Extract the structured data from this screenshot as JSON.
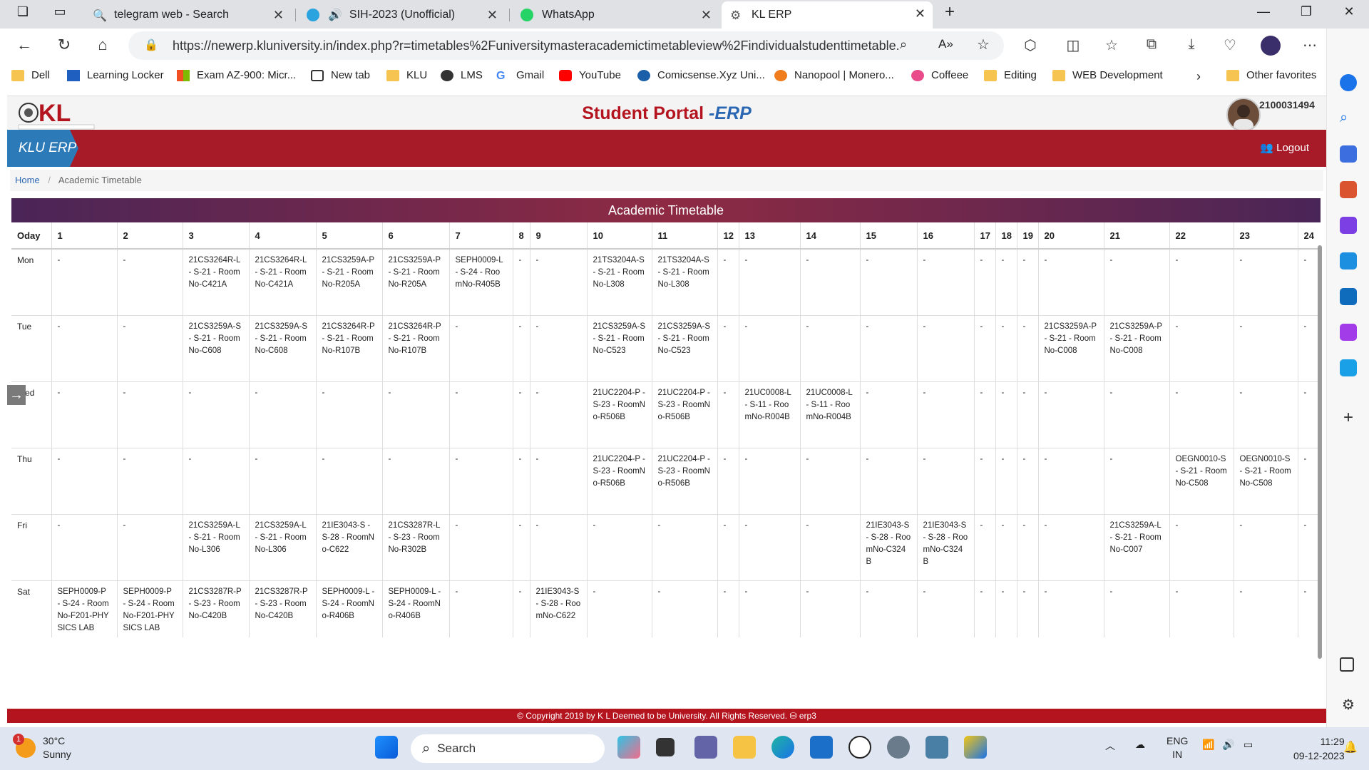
{
  "browser": {
    "tabs": [
      {
        "title": "telegram web - Search",
        "icon": "search-icon",
        "active": false
      },
      {
        "title": "SIH-2023 (Unofficial)",
        "icon": "telegram-icon",
        "active": false
      },
      {
        "title": "WhatsApp",
        "icon": "whatsapp-icon",
        "active": false
      },
      {
        "title": "KL ERP",
        "icon": "gear-icon",
        "active": true
      }
    ],
    "url": "https://newerp.kluniversity.in/index.php?r=timetables%2Funiversitymasteracademictimetableview%2Findividualstudenttimetable...",
    "bookmarks": [
      "Dell",
      "Learning Locker",
      "Exam AZ-900: Micr...",
      "New tab",
      "KLU",
      "LMS",
      "Gmail",
      "YouTube",
      "Comicsense.Xyz Uni...",
      "Nanopool | Monero...",
      "Coffeee",
      "Editing",
      "WEB Development",
      "Other favorites"
    ]
  },
  "portal": {
    "title": "Student Portal",
    "title_suffix": "-ERP",
    "student_id": "2100031494",
    "brand": "KLU ERP",
    "logout": "Logout",
    "breadcrumb_home": "Home",
    "breadcrumb_current": "Academic Timetable",
    "timetable_title": "Academic Timetable",
    "footer": "© Copyright 2019 by K L Deemed to be University. All Rights Reserved. ⛁ erp3"
  },
  "timetable": {
    "headers": [
      "Oday",
      "1",
      "2",
      "3",
      "4",
      "5",
      "6",
      "7",
      "8",
      "9",
      "10",
      "11",
      "12",
      "13",
      "14",
      "15",
      "16",
      "17",
      "18",
      "19",
      "20",
      "21",
      "22",
      "23",
      "24"
    ],
    "rows": [
      [
        "Mon",
        "-",
        "-",
        "21CS3264R-L - S-21 - RoomNo-C421A",
        "21CS3264R-L - S-21 - RoomNo-C421A",
        "21CS3259A-P - S-21 - RoomNo-R205A",
        "21CS3259A-P - S-21 - RoomNo-R205A",
        "SEPH0009-L - S-24 - RoomNo-R405B",
        "-",
        "-",
        "21TS3204A-S - S-21 - RoomNo-L308",
        "21TS3204A-S - S-21 - RoomNo-L308",
        "-",
        "-",
        "-",
        "-",
        "-",
        "-",
        "-",
        "-",
        "-",
        "-",
        "-",
        "-",
        "-"
      ],
      [
        "Tue",
        "-",
        "-",
        "21CS3259A-S - S-21 - RoomNo-C608",
        "21CS3259A-S - S-21 - RoomNo-C608",
        "21CS3264R-P - S-21 - RoomNo-R107B",
        "21CS3264R-P - S-21 - RoomNo-R107B",
        "-",
        "-",
        "-",
        "21CS3259A-S - S-21 - RoomNo-C523",
        "21CS3259A-S - S-21 - RoomNo-C523",
        "-",
        "-",
        "-",
        "-",
        "-",
        "-",
        "-",
        "-",
        "21CS3259A-P - S-21 - RoomNo-C008",
        "21CS3259A-P - S-21 - RoomNo-C008",
        "-",
        "-",
        "-"
      ],
      [
        "Wed",
        "-",
        "-",
        "-",
        "-",
        "-",
        "-",
        "-",
        "-",
        "-",
        "21UC2204-P - S-23 - RoomNo-R506B",
        "21UC2204-P - S-23 - RoomNo-R506B",
        "-",
        "21UC0008-L - S-11 - RoomNo-R004B",
        "21UC0008-L - S-11 - RoomNo-R004B",
        "-",
        "-",
        "-",
        "-",
        "-",
        "-",
        "-",
        "-",
        "-",
        "-"
      ],
      [
        "Thu",
        "-",
        "-",
        "-",
        "-",
        "-",
        "-",
        "-",
        "-",
        "-",
        "21UC2204-P - S-23 - RoomNo-R506B",
        "21UC2204-P - S-23 - RoomNo-R506B",
        "-",
        "-",
        "-",
        "-",
        "-",
        "-",
        "-",
        "-",
        "-",
        "-",
        "OEGN0010-S - S-21 - RoomNo-C508",
        "OEGN0010-S - S-21 - RoomNo-C508",
        "-"
      ],
      [
        "Fri",
        "-",
        "-",
        "21CS3259A-L - S-21 - RoomNo-L306",
        "21CS3259A-L - S-21 - RoomNo-L306",
        "21IE3043-S - S-28 - RoomNo-C622",
        "21CS3287R-L - S-23 - RoomNo-R302B",
        "-",
        "-",
        "-",
        "-",
        "-",
        "-",
        "-",
        "-",
        "21IE3043-S - S-28 - RoomNo-C324B",
        "21IE3043-S - S-28 - RoomNo-C324B",
        "-",
        "-",
        "-",
        "-",
        "21CS3259A-L - S-21 - RoomNo-C007",
        "-",
        "-",
        "-"
      ],
      [
        "Sat",
        "SEPH0009-P - S-24 - RoomNo-F201-PHYSICS LAB",
        "SEPH0009-P - S-24 - RoomNo-F201-PHYSICS LAB",
        "21CS3287R-P - S-23 - RoomNo-C420B",
        "21CS3287R-P - S-23 - RoomNo-C420B",
        "SEPH0009-L - S-24 - RoomNo-R406B",
        "SEPH0009-L - S-24 - RoomNo-R406B",
        "-",
        "-",
        "21IE3043-S - S-28 - RoomNo-C622",
        "-",
        "-",
        "-",
        "-",
        "-",
        "-",
        "-",
        "-",
        "-",
        "-",
        "-",
        "-",
        "-",
        "-",
        "-"
      ]
    ]
  },
  "taskbar": {
    "weather_badge": "1",
    "temperature": "30°C",
    "weather": "Sunny",
    "search": "Search",
    "lang_line1": "ENG",
    "lang_line2": "IN",
    "time": "11:29",
    "date": "09-12-2023"
  }
}
